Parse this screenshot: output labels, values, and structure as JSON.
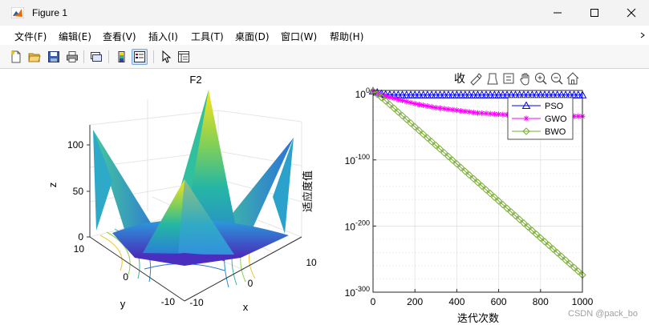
{
  "window": {
    "title": "Figure 1",
    "icon": "matlab-icon",
    "controls": [
      "minimize-icon",
      "maximize-icon",
      "close-icon"
    ]
  },
  "menu": {
    "items": [
      {
        "label": "文件(F)",
        "name": "menu-file"
      },
      {
        "label": "编辑(E)",
        "name": "menu-edit"
      },
      {
        "label": "查看(V)",
        "name": "menu-view"
      },
      {
        "label": "插入(I)",
        "name": "menu-insert"
      },
      {
        "label": "工具(T)",
        "name": "menu-tools"
      },
      {
        "label": "桌面(D)",
        "name": "menu-desktop"
      },
      {
        "label": "窗口(W)",
        "name": "menu-window"
      },
      {
        "label": "帮助(H)",
        "name": "menu-help"
      }
    ]
  },
  "toolbar": {
    "buttons": [
      "new-figure-icon",
      "open-file-icon",
      "save-icon",
      "print-icon",
      "link-plot-icon",
      "colorbar-icon",
      "legend-icon",
      "pointer-icon",
      "property-inspector-icon"
    ]
  },
  "axes_toolbar": {
    "label": "收",
    "buttons": [
      "brush-icon",
      "data-tip-icon",
      "rotate-icon",
      "pan-icon",
      "zoom-in-icon",
      "zoom-out-icon",
      "home-icon"
    ]
  },
  "surface_plot": {
    "title": "F2",
    "xlabel": "x",
    "ylabel": "y",
    "zlabel": "z",
    "z_ticks": [
      "0",
      "50",
      "100"
    ],
    "x_ticks": [
      "-10",
      "0",
      "10"
    ],
    "y_ticks": [
      "-10",
      "0",
      "10"
    ]
  },
  "chart_data": {
    "type": "line",
    "x": [
      0,
      50,
      100,
      150,
      200,
      250,
      300,
      350,
      400,
      450,
      500,
      550,
      600,
      650,
      700,
      750,
      800,
      850,
      900,
      950,
      1000
    ],
    "xlabel": "迭代次数",
    "ylabel": "适应度值",
    "xlim": [
      0,
      1000
    ],
    "ylim": [
      1e-300,
      100000.0
    ],
    "yscale": "log",
    "x_ticks": [
      "0",
      "200",
      "400",
      "600",
      "800",
      "1000"
    ],
    "y_ticks": [
      {
        "base": "10",
        "exp": "0",
        "log": 0
      },
      {
        "base": "10",
        "exp": "-100",
        "log": -100
      },
      {
        "base": "10",
        "exp": "-200",
        "log": -200
      },
      {
        "base": "10",
        "exp": "-300",
        "log": -300
      }
    ],
    "grid": true,
    "legend_position": "top-right",
    "series": [
      {
        "name": "PSO",
        "color": "#0000ff",
        "marker": "triangle",
        "log10_values": [
          4,
          -1,
          -2,
          -2,
          -2,
          -2,
          -2,
          -2,
          -2,
          -2,
          -2,
          -2,
          -2,
          -2,
          -2,
          -2,
          -2,
          -2,
          -2,
          -2,
          -2
        ]
      },
      {
        "name": "GWO",
        "color": "#ff00ff",
        "marker": "star",
        "log10_values": [
          4,
          -3,
          -7,
          -11,
          -15,
          -18,
          -21,
          -23,
          -25,
          -27,
          -29,
          -30,
          -31,
          -32,
          -33,
          -33,
          -34,
          -34,
          -34,
          -34,
          -34
        ]
      },
      {
        "name": "BWO",
        "color": "#77ac30",
        "marker": "diamond",
        "log10_values": [
          4,
          -8,
          -22,
          -36,
          -50,
          -64,
          -78,
          -92,
          -106,
          -120,
          -134,
          -148,
          -162,
          -176,
          -190,
          -204,
          -218,
          -232,
          -246,
          -260,
          -274
        ]
      }
    ]
  },
  "watermark": "CSDN @pack_bo"
}
